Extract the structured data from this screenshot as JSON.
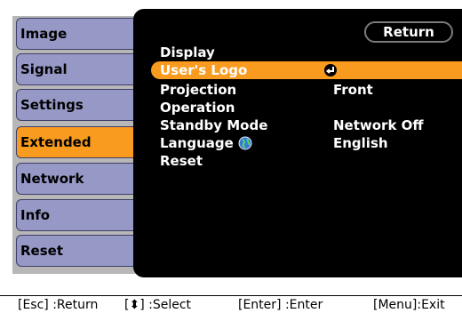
{
  "sidebar": {
    "items": [
      {
        "label": "Image",
        "active": false
      },
      {
        "label": "Signal",
        "active": false
      },
      {
        "label": "Settings",
        "active": false
      },
      {
        "label": "Extended",
        "active": true
      },
      {
        "label": "Network",
        "active": false
      },
      {
        "label": "Info",
        "active": false
      },
      {
        "label": "Reset",
        "active": false
      }
    ]
  },
  "main": {
    "return_label": "Return",
    "rows": [
      {
        "label": "Display",
        "value": ""
      },
      {
        "label": "User's Logo",
        "value": "",
        "icon": "enter-icon",
        "active": true
      },
      {
        "label": "Projection",
        "value": "Front"
      },
      {
        "label": "Operation",
        "value": ""
      },
      {
        "label": "Standby Mode",
        "value": "Network Off"
      },
      {
        "label": "Language",
        "value": "English",
        "icon": "globe-icon"
      },
      {
        "label": "Reset",
        "value": ""
      }
    ]
  },
  "footer": {
    "esc": "[Esc] :Return",
    "select": "[⬍] :Select",
    "enter": "[Enter] :Enter",
    "menu": "[Menu]:Exit"
  },
  "colors": {
    "sidebar_item": "#9698c6",
    "active": "#f99b1f",
    "background": "#000000"
  }
}
